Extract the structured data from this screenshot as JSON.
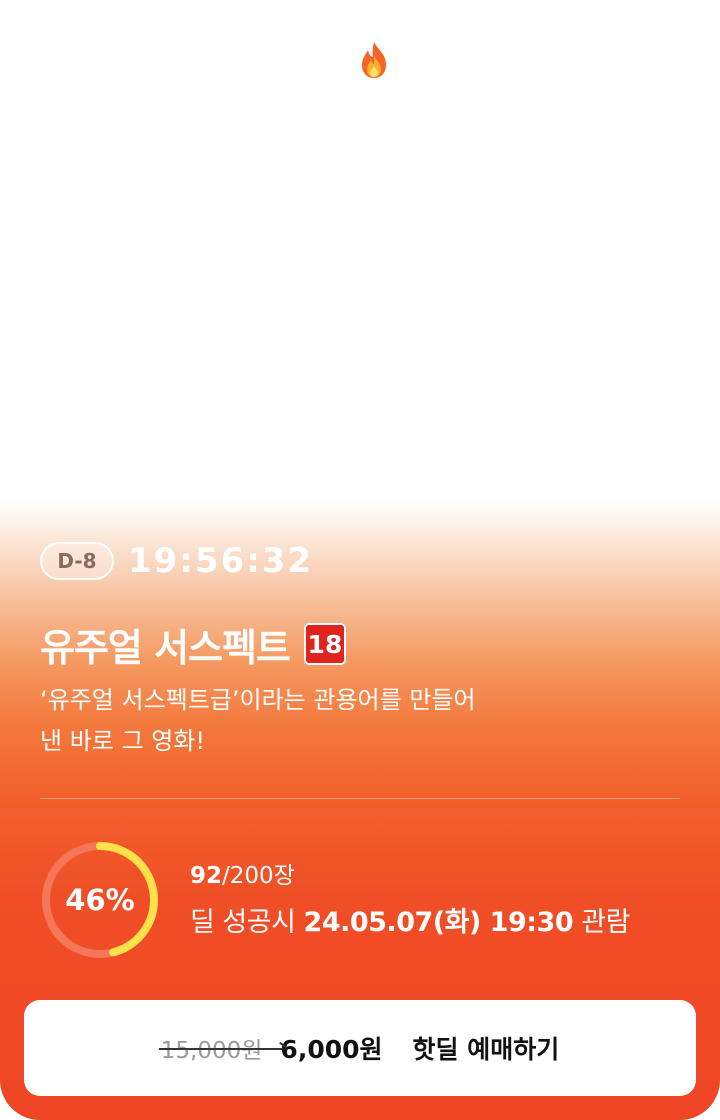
{
  "header": {
    "icon": "fire-icon"
  },
  "deal": {
    "dday": "D-8",
    "countdown": "19:56:32"
  },
  "movie": {
    "title": "유주얼 서스펙트",
    "rating": "18",
    "description": "‘유주얼 서스펙트급’이라는 관용어를 만들어낸 바로 그 영화!"
  },
  "progress": {
    "percent_label": "46%",
    "fraction": 0.46,
    "sold": "92",
    "total": "/200장",
    "deal_prefix": "딜 성공시 ",
    "show_time": "24.05.07(화) 19:30",
    "deal_suffix": " 관람"
  },
  "booking": {
    "original_price": "15,000원",
    "sale_price": "6,000원",
    "label": "핫딜 예매하기"
  },
  "colors": {
    "accent": "#ee4524",
    "ring_track": "#f4775a",
    "ring_fill": "#ffe14a",
    "rating_badge": "#e0231c"
  }
}
